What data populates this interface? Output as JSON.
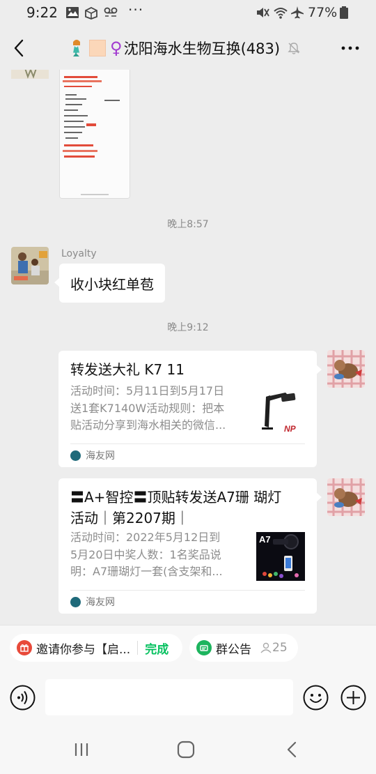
{
  "status_bar": {
    "time": "9:22",
    "battery_pct": "77%",
    "more_dots": "···"
  },
  "header": {
    "title": "沈阳海水生物互换(483)",
    "venus_symbol": "♀"
  },
  "messages": {
    "timestamp_1": "晚上8:57",
    "sender_name": "Loyalty",
    "text_message": "收小块红单苞",
    "timestamp_2": "晚上9:12",
    "card_1": {
      "title": "转发送大礼 K7 11",
      "desc_line1": "活动时间：5月11日到5月17日",
      "desc_line2": "送1套K7140W活动规则：把本",
      "desc_line3": "贴活动分享到海水相关的微信...",
      "source": "海友网"
    },
    "card_2": {
      "title_line1": "〓A+智控〓顶贴转发送A7珊 瑚灯",
      "title_line2": "活动｜第2207期｜",
      "desc_line1": "活动时间：2022年5月12日到",
      "desc_line2": "5月20日中奖人数：1名奖品说",
      "desc_line3": "明：A7珊瑚灯一套(含支架和...",
      "source": "海友网",
      "thumb_label": "A7"
    }
  },
  "pills": {
    "invite_text": "邀请你参与【启...",
    "invite_action": "完成",
    "announcement_label": "群公告",
    "member_count": "25"
  },
  "input": {
    "placeholder": ""
  },
  "colors": {
    "accent_green": "#07c160",
    "background": "#ededed",
    "bubble": "#ffffff"
  }
}
